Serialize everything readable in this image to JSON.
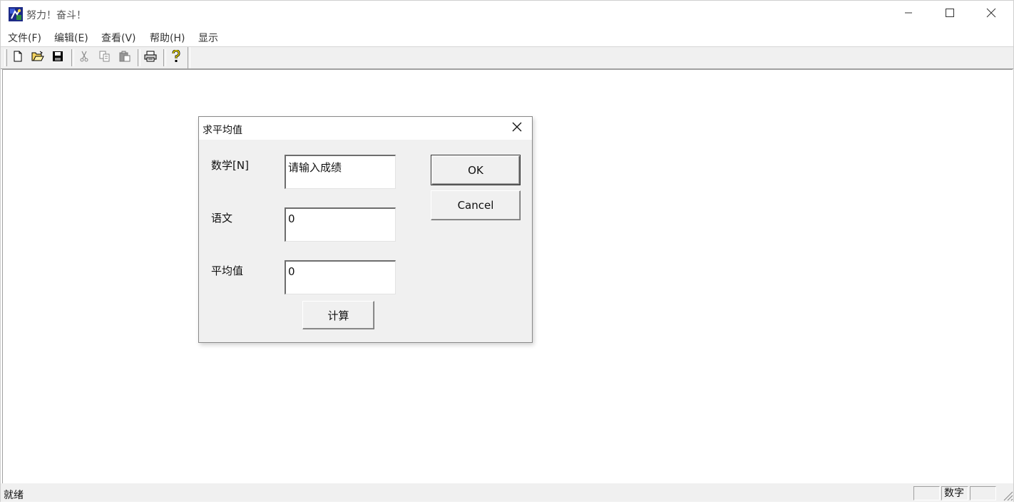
{
  "window": {
    "title": "努力！奋斗！",
    "icon": "app-icon",
    "controls": [
      "minimize-icon",
      "maximize-icon",
      "close-icon"
    ]
  },
  "menu": {
    "items": [
      "文件(F)",
      "编辑(E)",
      "查看(V)",
      "帮助(H)",
      "显示"
    ]
  },
  "toolbar": {
    "buttons": [
      {
        "icon": "new-file-icon",
        "enabled": true
      },
      {
        "icon": "open-folder-icon",
        "enabled": true
      },
      {
        "icon": "save-icon",
        "enabled": true
      },
      {
        "icon": "cut-icon",
        "enabled": false
      },
      {
        "icon": "copy-icon",
        "enabled": false
      },
      {
        "icon": "paste-icon",
        "enabled": false
      },
      {
        "icon": "print-icon",
        "enabled": true
      },
      {
        "icon": "help-icon",
        "enabled": true
      }
    ]
  },
  "dialog": {
    "title": "求平均值",
    "math_label": "数学[N]",
    "math_value": "请输入成绩",
    "chinese_label": "语文",
    "chinese_value": "0",
    "average_label": "平均值",
    "average_value": "0",
    "ok_label": "OK",
    "cancel_label": "Cancel",
    "calc_label": "计算"
  },
  "status": {
    "text": "就绪",
    "panes": [
      "",
      "数字",
      ""
    ]
  },
  "colors": {
    "dialog_bg": "#f0f0f0",
    "toolbar_bg": "#f0f0f0",
    "window_bg": "#ffffff"
  }
}
